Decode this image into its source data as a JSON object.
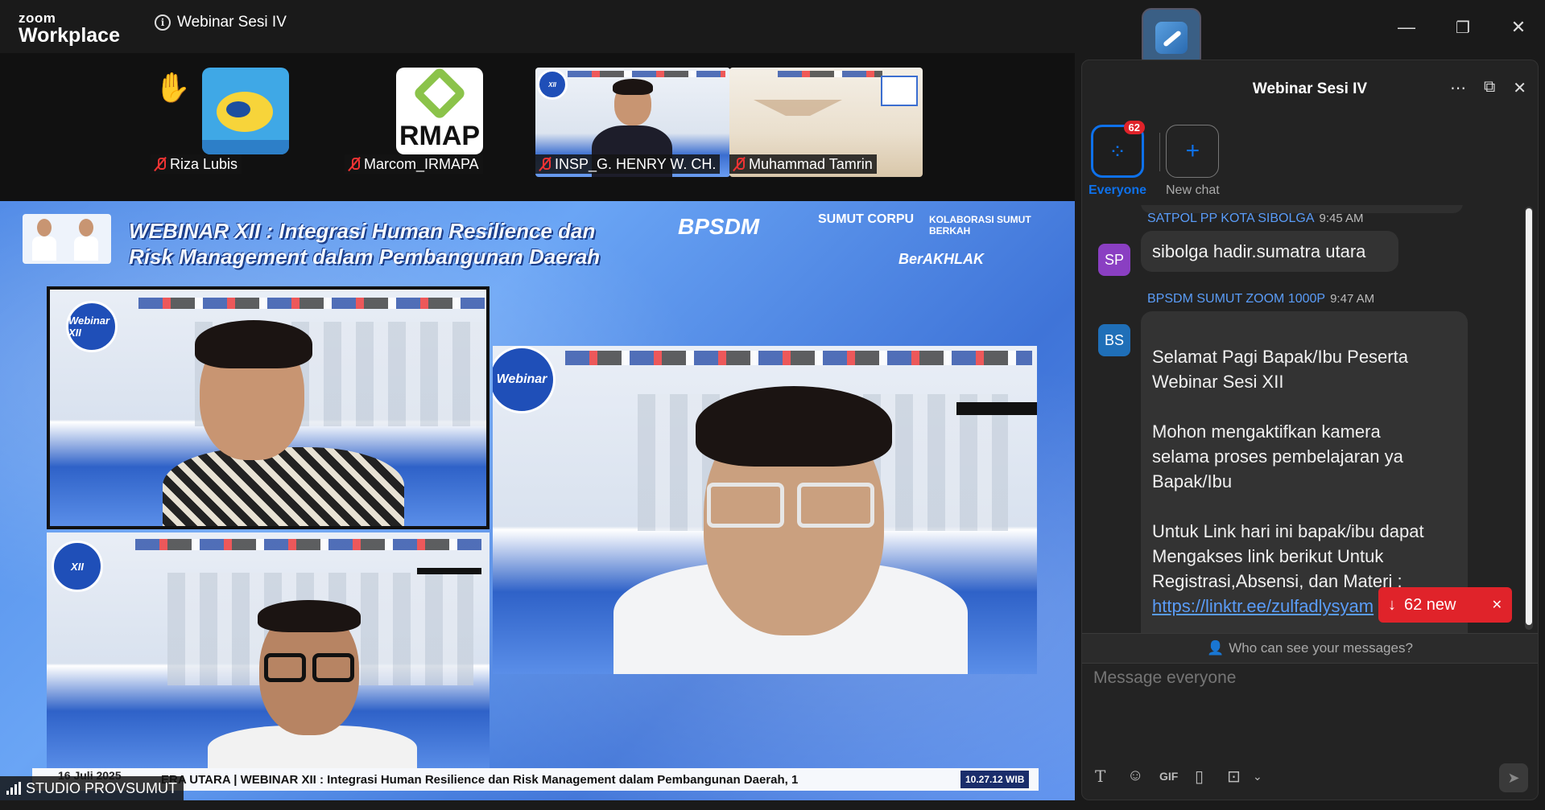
{
  "app": {
    "brand_top": "zoom",
    "brand_bottom": "Workplace",
    "meeting_title": "Webinar Sesi IV"
  },
  "window_controls": {
    "minimize": "—",
    "restore": "❐",
    "close": "✕"
  },
  "participants": [
    {
      "name": "Riza Lubis",
      "muted": true,
      "hand_raised": true
    },
    {
      "name": "Marcom_IRMAPA",
      "muted": true,
      "logo_text": "RMAP"
    },
    {
      "name": "INSP_G. HENRY W. CH.",
      "muted": true
    },
    {
      "name": "Muhammad Tamrin",
      "muted": true
    }
  ],
  "main_video": {
    "title_line1": "WEBINAR XII : Integrasi Human Resilience dan",
    "title_line2": "Risk Management dalam Pembangunan Daerah",
    "brand_bpsdm": "BPSDM",
    "brand_corpu": "SUMUT CORPU",
    "brand_kolaborasi": "KOLABORASI SUMUT BERKAH",
    "brand_berakhlak": "BerAKHLAK",
    "webinar_badge": "Webinar XII",
    "ticker_text": "ERA UTARA  |  WEBINAR XII : Integrasi Human Resilience dan Risk Management dalam Pembangunan Daerah, 1",
    "ticker_date": "16 Juli 2025",
    "ticker_time": "10.27.12 WIB",
    "studio_label": "STUDIO PROVSUMUT"
  },
  "chat": {
    "title": "Webinar Sesi IV",
    "header_icons": [
      "more-icon",
      "popout-icon",
      "close-icon"
    ],
    "channels": [
      {
        "label": "Everyone",
        "badge": "62",
        "active": true
      },
      {
        "label": "New chat",
        "active": false
      }
    ],
    "messages": [
      {
        "sender": "SATPOL PP KOTA SIBOLGA",
        "time": "9:45 AM",
        "initials": "SP",
        "color": "#8a3fc2",
        "text": "sibolga hadir.sumatra utara"
      },
      {
        "sender": "BPSDM SUMUT ZOOM 1000P",
        "time": "9:47 AM",
        "initials": "BS",
        "color": "#1f6fb8",
        "text": "Selamat Pagi Bapak/Ibu Peserta\nWebinar Sesi XII\n\nMohon mengaktifkan kamera\nselama proses pembelajaran ya\nBapak/Ibu\n\nUntuk Link hari ini bapak/ibu dapat\nMengakses link berikut Untuk\nRegistrasi,Absensi, dan Materi :",
        "link": "https://linktr.ee/zulfadlysyam"
      }
    ],
    "new_messages": "62 new",
    "visibility_note": "Who can see your messages?",
    "input_placeholder": "Message everyone",
    "toolbar": {
      "gif_label": "GIF"
    }
  },
  "colors": {
    "accent": "#0e71eb",
    "alert": "#e0232a",
    "link": "#5a9cf8"
  }
}
